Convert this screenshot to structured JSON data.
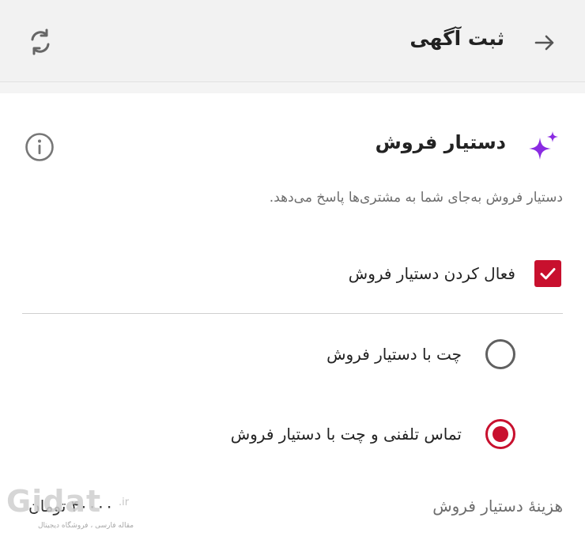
{
  "header": {
    "title": "ثبت آگهی"
  },
  "section": {
    "title": "دستیار فروش",
    "description": "دستیار فروش به‌جای شما به مشتری‌ها پاسخ می‌دهد."
  },
  "checkbox": {
    "label": "فعال کردن دستیار فروش",
    "checked": true
  },
  "radio_options": [
    {
      "label": "چت با دستیار فروش",
      "selected": false
    },
    {
      "label": "تماس تلفنی و چت با دستیار فروش",
      "selected": true
    }
  ],
  "cost": {
    "label": "هزینهٔ دستیار فروش",
    "value": "۴۰۰۰۰ تومان"
  },
  "watermark": {
    "logo": "Gidat",
    "suffix": ".ir",
    "subtitle": "مقاله فارسی ، فروشگاه دیجیتال"
  },
  "colors": {
    "accent": "#c8102e",
    "sparkle": "#8a2be2",
    "header_bg": "#f2f2f2"
  },
  "icons": {
    "back": "arrow-right-icon",
    "refresh": "refresh-icon",
    "sparkle": "sparkle-icon",
    "info": "info-icon"
  }
}
